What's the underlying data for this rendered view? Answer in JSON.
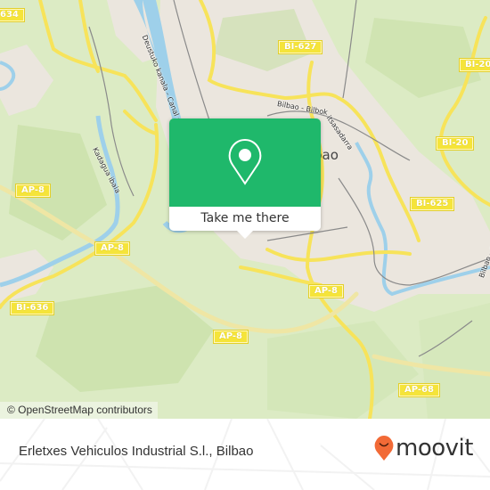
{
  "map": {
    "road_shields": [
      {
        "id": "bi634",
        "label": "634"
      },
      {
        "id": "bi627",
        "label": "BI-627"
      },
      {
        "id": "bi20a",
        "label": "BI-20"
      },
      {
        "id": "bi20b",
        "label": "BI-20"
      },
      {
        "id": "bi625",
        "label": "BI-625"
      },
      {
        "id": "ap8a",
        "label": "AP-8"
      },
      {
        "id": "ap8b",
        "label": "AP-8"
      },
      {
        "id": "ap8c",
        "label": "AP-8"
      },
      {
        "id": "ap8d",
        "label": "AP-8"
      },
      {
        "id": "bi636",
        "label": "BI-636"
      },
      {
        "id": "ap68",
        "label": "AP-68"
      }
    ],
    "street_labels": {
      "deustu": "Deustuko kanala - Canal de",
      "kadagua": "Kadagua ibaia",
      "bilbao_bilbo": "Bilbao - Bilbok",
      "itsasadarra": "itsasadarra",
      "right_edge": "Bilbao - oreka"
    },
    "city_label": "bao",
    "attribution": "© OpenStreetMap contributors",
    "colors": {
      "land": "#dcebc4",
      "urban": "#ece7e0",
      "forest": "#c9e0aa",
      "water": "#9ed0ea",
      "highway": "#f7e35a",
      "rail": "#8a8a8a"
    }
  },
  "popup": {
    "button_label": "Take me there",
    "icon": "location-pin-icon",
    "color": "#1fb86b"
  },
  "footer": {
    "title": "Erletxes Vehiculos Industrial S.l., Bilbao",
    "brand": "moovit",
    "brand_color": "#f26a36"
  }
}
